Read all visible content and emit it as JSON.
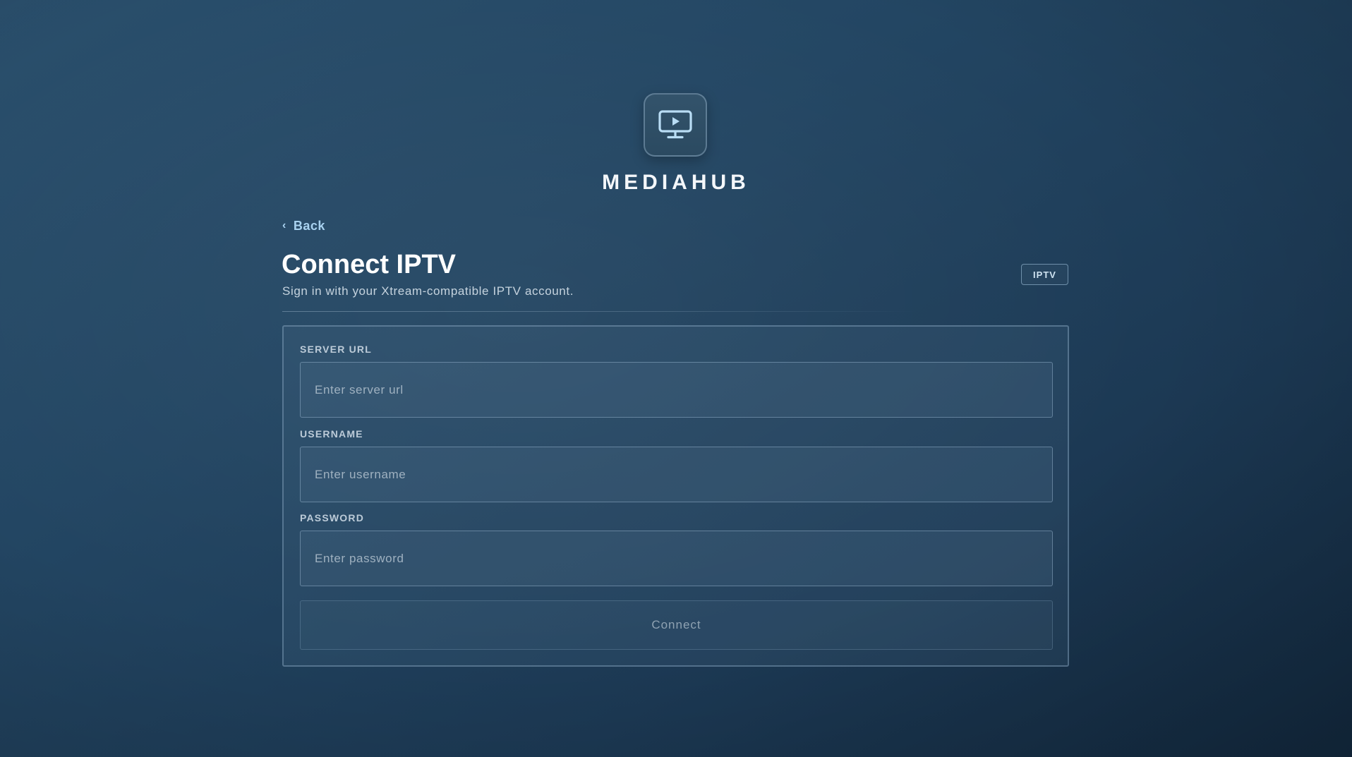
{
  "brand": {
    "logo_icon": "monitor-play-icon",
    "name": "MEDIAHUB"
  },
  "nav": {
    "back_icon": "chevron-left-icon",
    "back_chevron": "‹",
    "back_label": "Back"
  },
  "header": {
    "title": "Connect IPTV",
    "subtitle": "Sign in with your Xtream-compatible IPTV account.",
    "badge": "IPTV"
  },
  "form": {
    "server_url": {
      "label": "SERVER URL",
      "placeholder": "Enter server url",
      "value": ""
    },
    "username": {
      "label": "USERNAME",
      "placeholder": "Enter username",
      "value": ""
    },
    "password": {
      "label": "PASSWORD",
      "placeholder": "Enter password",
      "value": ""
    },
    "submit_label": "Connect"
  },
  "colors": {
    "background_top": "#2a4f6c",
    "background_bottom": "#132a40",
    "accent_link": "#a9d2f0",
    "logo_tile": "#2f4f66"
  }
}
